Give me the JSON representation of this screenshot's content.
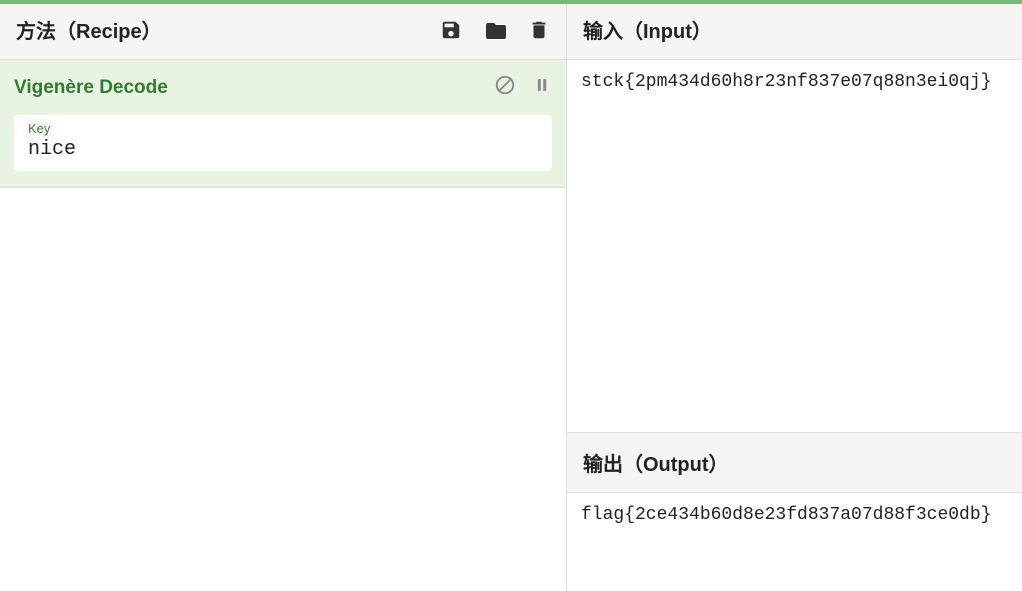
{
  "recipe": {
    "title": "方法（Recipe）",
    "operation": {
      "name": "Vigenère Decode",
      "key_label": "Key",
      "key_value": "nice"
    }
  },
  "input": {
    "title": "输入（Input）",
    "value": "stck{2pm434d60h8r23nf837e07q88n3ei0qj}"
  },
  "output": {
    "title": "输出（Output）",
    "value": "flag{2ce434b60d8e23fd837a07d88f3ce0db}"
  }
}
